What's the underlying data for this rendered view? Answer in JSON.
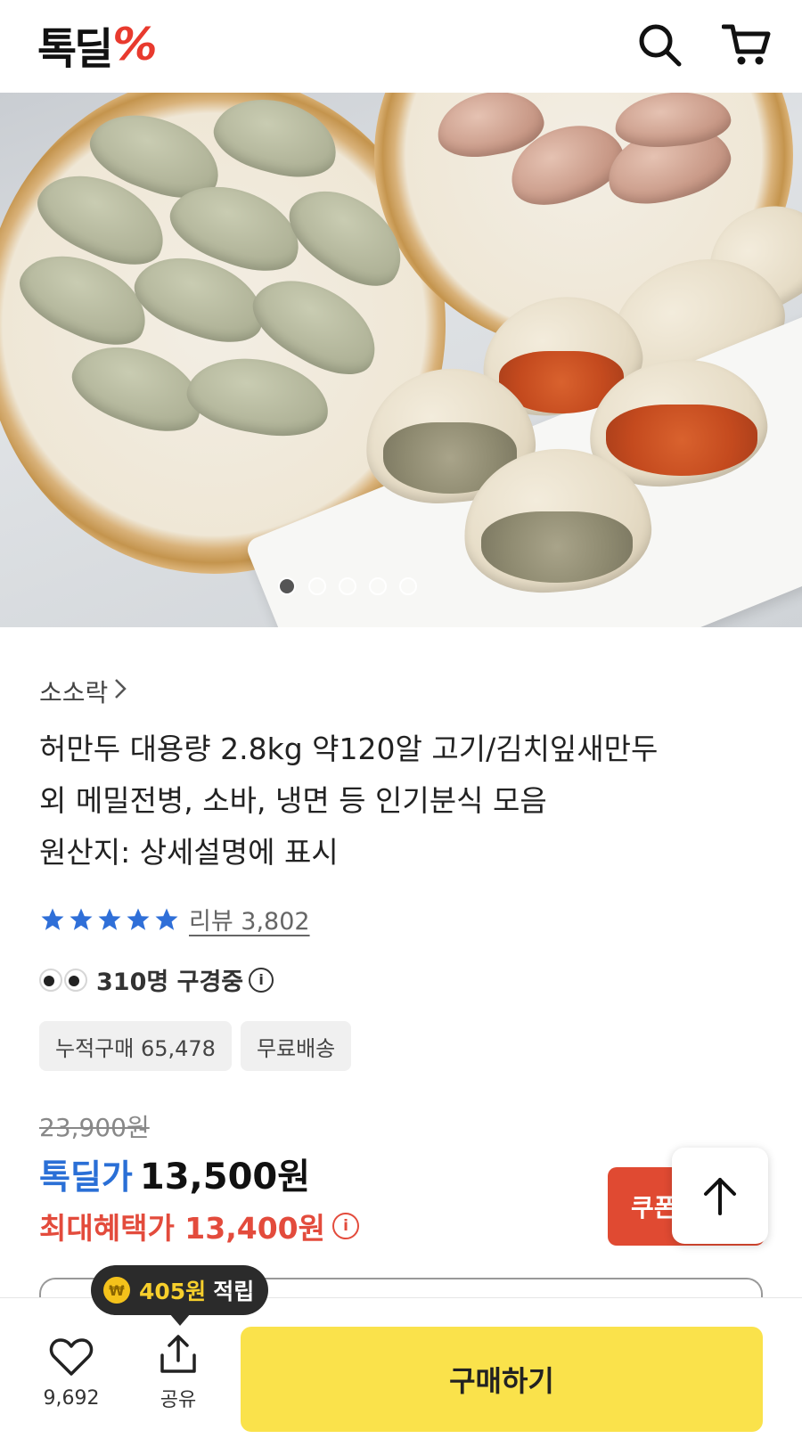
{
  "header": {
    "logo_text": "톡딜",
    "logo_mark": "%",
    "icons": [
      "search-icon",
      "cart-icon"
    ]
  },
  "hero": {
    "slide_count": 5,
    "active_slide": 1
  },
  "product": {
    "brand": "소소락",
    "title_lines": [
      "허만두 대용량 2.8kg 약120알 고기/김치잎새만두",
      "외 메밀전병, 소바, 냉면 등 인기분식 모음",
      "원산지: 상세설명에 표시"
    ],
    "rating_stars": 5,
    "review_label": "리뷰 3,802",
    "viewing_text": "310명 구경중",
    "tags": [
      "누적구매 65,478",
      "무료배송"
    ],
    "original_price": "23,900원",
    "deal_label": "톡딜가",
    "deal_price": "13,500원",
    "max_benefit_text": "최대혜택가 13,400원",
    "coupon_label": "쿠폰"
  },
  "bottom_bar": {
    "like_count": "9,692",
    "share_label": "공유",
    "buy_label": "구매하기",
    "points_amount": "405원",
    "points_suffix": "적립"
  },
  "colors": {
    "accent_red": "#e83a2e",
    "deal_blue": "#2a6fd6",
    "benefit_red": "#e34b3c",
    "buy_yellow": "#fae24b",
    "star_blue": "#2f6fd8"
  }
}
